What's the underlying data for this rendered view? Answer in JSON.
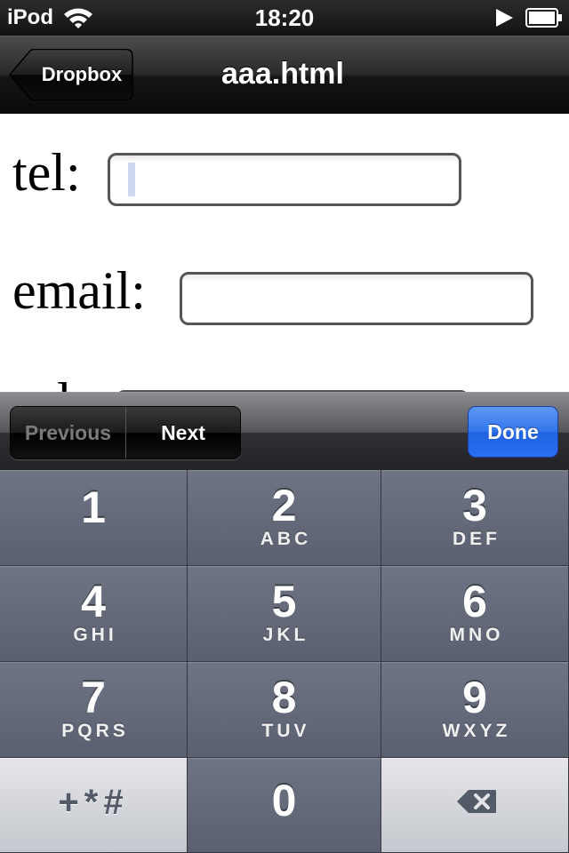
{
  "status_bar": {
    "carrier": "iPod",
    "time": "18:20",
    "icons": [
      "wifi-icon",
      "play-icon",
      "battery-icon"
    ]
  },
  "nav_bar": {
    "back_label": "Dropbox",
    "title": "aaa.html"
  },
  "form": {
    "fields": [
      {
        "label": "tel:",
        "value": ""
      },
      {
        "label": "email:",
        "value": ""
      },
      {
        "label": "url:",
        "value": ""
      }
    ]
  },
  "form_toolbar": {
    "previous_label": "Previous",
    "next_label": "Next",
    "done_label": "Done",
    "done_color": "#2a6ff0"
  },
  "keypad": {
    "keys": [
      {
        "digit": "1",
        "letters": ""
      },
      {
        "digit": "2",
        "letters": "ABC"
      },
      {
        "digit": "3",
        "letters": "DEF"
      },
      {
        "digit": "4",
        "letters": "GHI"
      },
      {
        "digit": "5",
        "letters": "JKL"
      },
      {
        "digit": "6",
        "letters": "MNO"
      },
      {
        "digit": "7",
        "letters": "PQRS"
      },
      {
        "digit": "8",
        "letters": "TUV"
      },
      {
        "digit": "9",
        "letters": "WXYZ"
      }
    ],
    "symbols_label": "+*#",
    "zero_digit": "0",
    "delete_icon": "backspace-icon"
  }
}
